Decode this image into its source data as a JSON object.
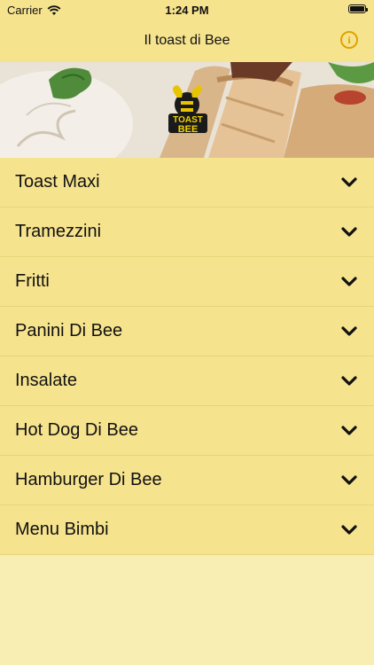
{
  "status_bar": {
    "carrier": "Carrier",
    "time": "1:24 PM"
  },
  "nav": {
    "title": "Il toast di Bee",
    "info_icon": "info-icon",
    "accent": "#e0a400"
  },
  "hero": {
    "logo_text_top": "TOAST",
    "logo_text_bottom": "BEE"
  },
  "menu": {
    "items": [
      {
        "label": "Toast Maxi"
      },
      {
        "label": "Tramezzini"
      },
      {
        "label": "Fritti"
      },
      {
        "label": "Panini Di Bee"
      },
      {
        "label": "Insalate"
      },
      {
        "label": "Hot Dog Di Bee"
      },
      {
        "label": "Hamburger Di Bee"
      },
      {
        "label": "Menu Bimbi"
      }
    ]
  },
  "colors": {
    "bar": "#f6e38e",
    "background": "#f8eeb4"
  }
}
